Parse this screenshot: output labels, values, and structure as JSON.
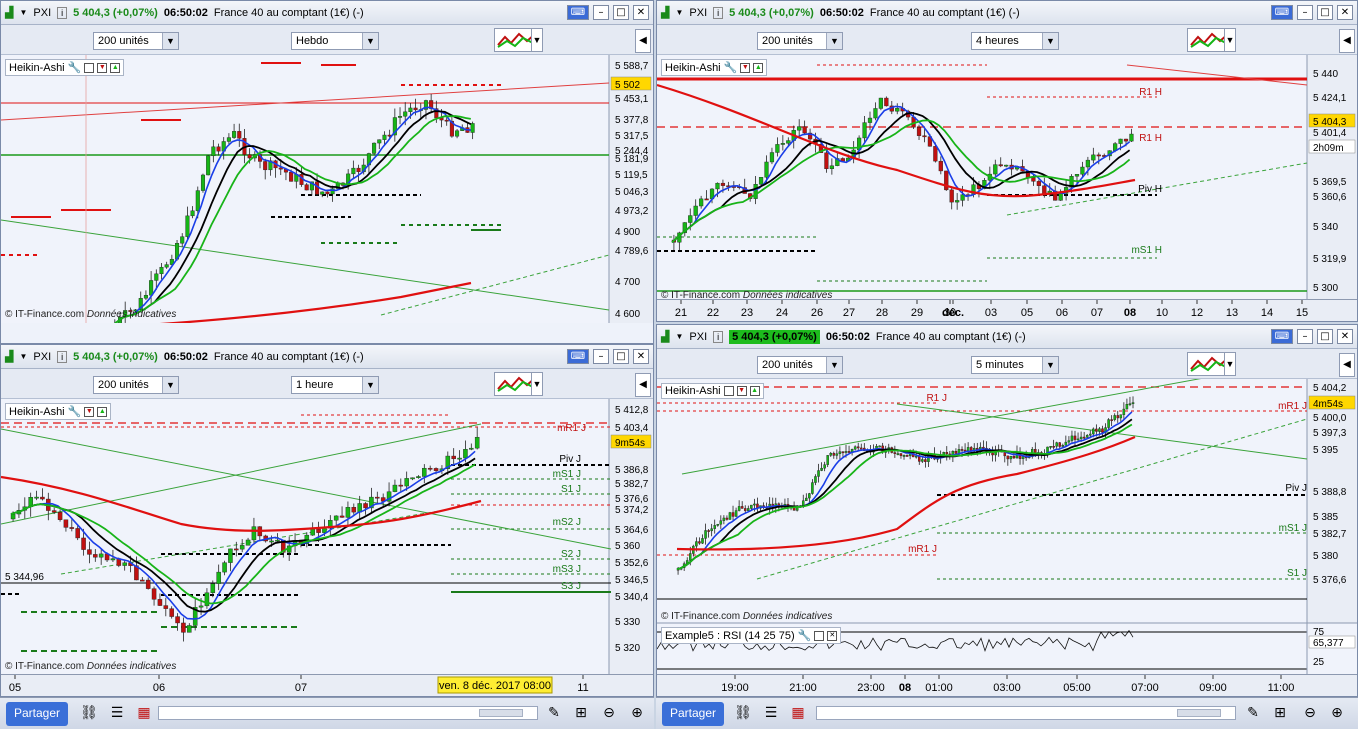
{
  "colors": {
    "up": "#16b516",
    "down": "#c01010",
    "ma_black": "#000000",
    "ma_blue": "#1a3ee8",
    "ma_green": "#18b418",
    "ma_red": "#e01010",
    "accent": "#3a6fd8"
  },
  "panes": [
    {
      "symbol": "PXI",
      "price_change": "5 404,3 (+0,07%)",
      "time": "06:50:02",
      "instrument": "France 40 au comptant (1€) (-)",
      "units": "200 unités",
      "period": "Hebdo",
      "indicator": "Heikin-Ashi",
      "copyright": "© IT-Finance.com",
      "disclaimer": "Données indicatives",
      "price_labels": [
        "5 588,7",
        "5 502",
        "5 453,1",
        "5 377,8",
        "5 317,5",
        "5 244,4",
        "5 181,9",
        "5 119,5",
        "5 046,3",
        "4 973,2",
        "4 900",
        "4 789,6",
        "4 700",
        "4 600"
      ],
      "x_labels": [],
      "line_labels": []
    },
    {
      "symbol": "PXI",
      "price_change": "5 404,3 (+0,07%)",
      "time": "06:50:02",
      "instrument": "France 40 au comptant (1€) (-)",
      "units": "200 unités",
      "period": "4 heures",
      "indicator": "Heikin-Ashi",
      "copyright": "© IT-Finance.com",
      "disclaimer": "Données indicatives",
      "price_labels": [
        "5 440",
        "5 424,1",
        "5 404,3",
        "5 401,4",
        "2h09m",
        "5 369,5",
        "5 360,6",
        "5 340",
        "5 319,9",
        "5 300"
      ],
      "x_labels": [
        "21",
        "22",
        "23",
        "24",
        "26",
        "27",
        "28",
        "29",
        "30",
        "déc.",
        "03",
        "05",
        "06",
        "07",
        "08",
        "10",
        "12",
        "13",
        "14",
        "15"
      ],
      "line_labels": [
        "R1 H",
        "R1 H",
        "Piv H",
        "mS1 H"
      ]
    },
    {
      "symbol": "PXI",
      "price_change": "5 404,3 (+0,07%)",
      "time": "06:50:02",
      "instrument": "France 40 au comptant (1€) (-)",
      "units": "200 unités",
      "period": "1 heure",
      "indicator": "Heikin-Ashi",
      "copyright": "© IT-Finance.com",
      "disclaimer": "Données indicatives",
      "price_labels": [
        "5 412,8",
        "5 403,4",
        "9m54s",
        "5 386,8",
        "5 382,7",
        "5 376,6",
        "5 374,2",
        "5 364,6",
        "5 360",
        "5 352,6",
        "5 346,5",
        "5 340,4",
        "5 330",
        "5 320"
      ],
      "x_labels": [
        "05",
        "06",
        "07",
        "11"
      ],
      "date_tag": "ven. 8 déc. 2017 08:00",
      "level_tag": "5 344,96",
      "line_labels": [
        "mR1 J",
        "Piv J",
        "mS1 J",
        "S1 J",
        "mS2 J",
        "S2 J",
        "mS3 J",
        "S3 J"
      ]
    },
    {
      "symbol": "PXI",
      "price_change": "5 404,3 (+0,07%)",
      "time": "06:50:02",
      "instrument": "France 40 au comptant (1€) (-)",
      "units": "200 unités",
      "period": "5 minutes",
      "indicator": "Heikin-Ashi",
      "copyright": "© IT-Finance.com",
      "disclaimer": "Données indicatives",
      "price_labels": [
        "5 404,2",
        "4m54s",
        "5 400,0",
        "5 397,3",
        "5 395",
        "5 388,8",
        "5 385",
        "5 382,7",
        "5 380",
        "5 376,6"
      ],
      "x_labels": [
        "19:00",
        "21:00",
        "23:00",
        "08",
        "01:00",
        "03:00",
        "05:00",
        "07:00",
        "09:00",
        "11:00"
      ],
      "line_labels": [
        "R1 J",
        "mR1 J",
        "Piv J",
        "mS1 J",
        "mR1 J",
        "S1 J"
      ],
      "rsi_label": "Example5 : RSI (14 25 75)",
      "rsi_labels": [
        "75",
        "65,377",
        "25"
      ]
    }
  ],
  "bottom": {
    "share_label": "Partager"
  }
}
